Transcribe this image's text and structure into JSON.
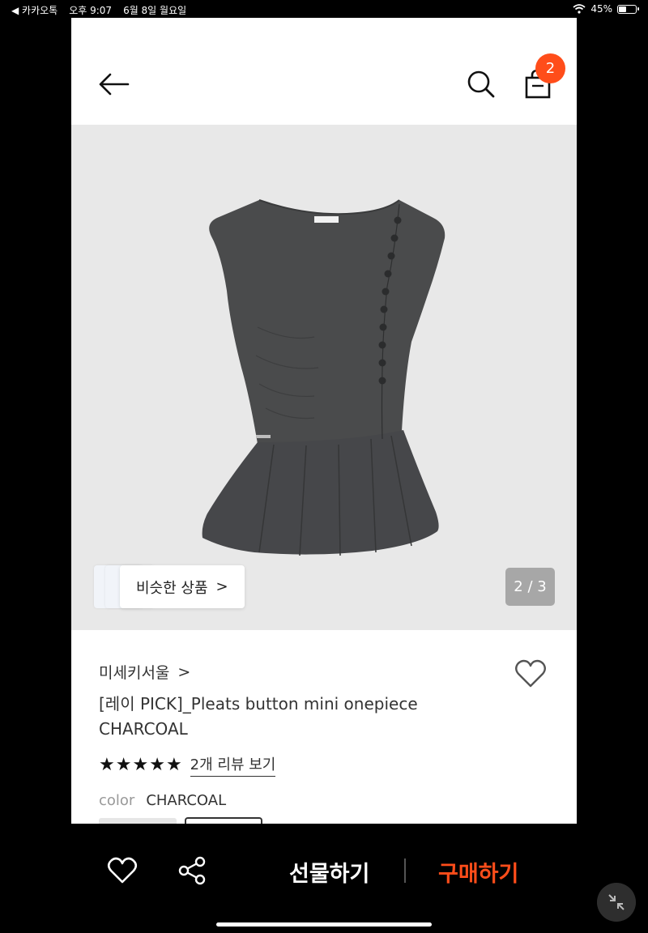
{
  "status_bar": {
    "back_app": "◀ 카카오톡",
    "time": "오후 9:07",
    "date": "6월 8일 월요일",
    "battery_percent": "45%",
    "battery_level": 0.45
  },
  "header": {
    "cart_count": "2"
  },
  "product_image": {
    "similar_label": "비슷한 상품",
    "similar_chevron": ">",
    "pager": "2 / 3"
  },
  "product": {
    "brand": "미세키서울",
    "brand_chevron": ">",
    "title_line1": "[레이 PICK]_Pleats button mini onepiece",
    "title_line2": "CHARCOAL",
    "rating_stars": 5,
    "review_link": "2개 리뷰 보기",
    "option_label": "color",
    "option_value": "CHARCOAL"
  },
  "bottom_bar": {
    "gift_label": "선물하기",
    "buy_label": "구매하기"
  },
  "colors": {
    "accent": "#ff4d1a",
    "image_bg": "#e8e8e8",
    "dress": "#4a4b4c"
  }
}
